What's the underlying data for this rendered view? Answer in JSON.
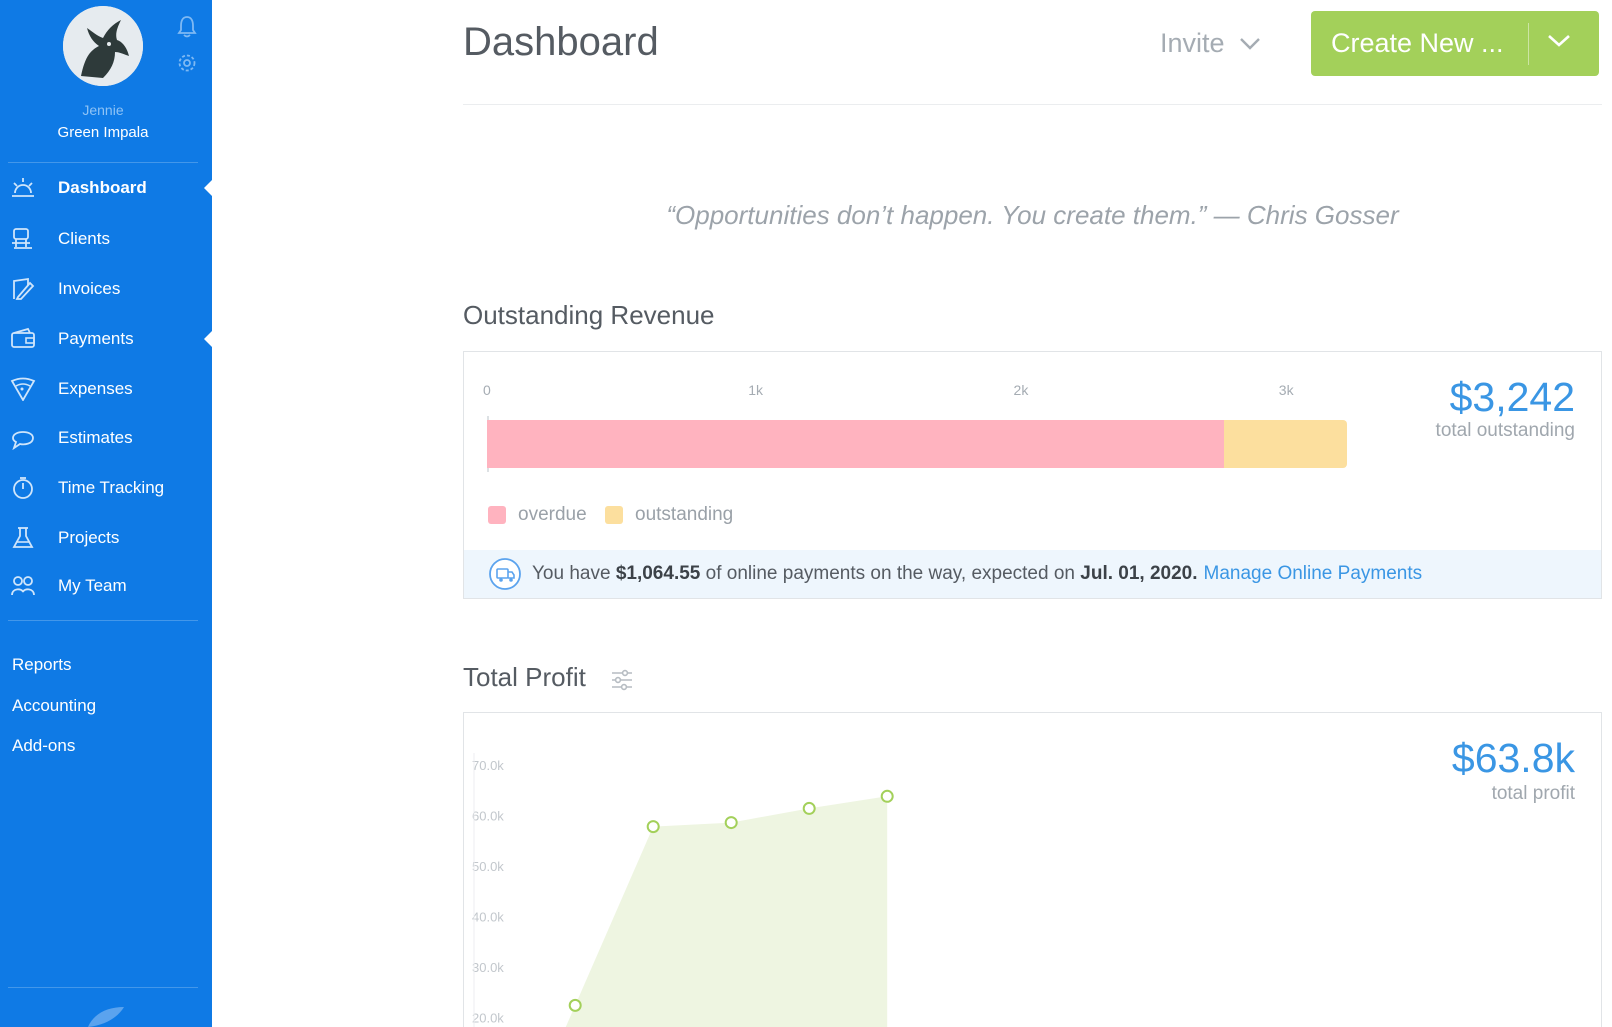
{
  "sidebar": {
    "user_first_name": "Jennie",
    "user_company": "Green Impala",
    "nav": [
      {
        "label": "Dashboard",
        "icon": "sun-icon",
        "active": true
      },
      {
        "label": "Clients",
        "icon": "clients-icon"
      },
      {
        "label": "Invoices",
        "icon": "invoice-icon"
      },
      {
        "label": "Payments",
        "icon": "wallet-icon"
      },
      {
        "label": "Expenses",
        "icon": "expenses-icon"
      },
      {
        "label": "Estimates",
        "icon": "estimate-icon"
      },
      {
        "label": "Time Tracking",
        "icon": "stopwatch-icon"
      },
      {
        "label": "Projects",
        "icon": "flask-icon"
      },
      {
        "label": "My Team",
        "icon": "team-icon"
      }
    ],
    "secondary": [
      "Reports",
      "Accounting",
      "Add-ons"
    ],
    "colors": {
      "background": "#0f7ae5"
    }
  },
  "header": {
    "title": "Dashboard",
    "invite_label": "Invite",
    "create_label": "Create New ...",
    "create_color": "#a3d05a"
  },
  "quote": "“Opportunities don’t happen. You create them.” — Chris Gosser",
  "outstanding": {
    "title": "Outstanding Revenue",
    "amount": "$3,242",
    "amount_label": "total outstanding",
    "ticks": [
      "0",
      "1k",
      "2k",
      "3k"
    ],
    "legend": [
      {
        "label": "overdue",
        "color": "#ffb3bf"
      },
      {
        "label": "outstanding",
        "color": "#fcdf9e"
      }
    ],
    "notice": {
      "prefix": "You have",
      "amount": "$1,064.55",
      "middle": "of online payments on the way, expected on",
      "date": "Jul. 01, 2020.",
      "link": "Manage Online Payments"
    }
  },
  "profit": {
    "title": "Total Profit",
    "amount": "$63.8k",
    "amount_label": "total profit"
  },
  "chart_data": [
    {
      "type": "bar",
      "orientation": "horizontal",
      "stacked": true,
      "categories": [
        "total outstanding"
      ],
      "series": [
        {
          "name": "overdue",
          "values": [
            2780
          ],
          "color": "#ffb3bf"
        },
        {
          "name": "outstanding",
          "values": [
            462
          ],
          "color": "#fcdf9e"
        }
      ],
      "x_ticks": [
        "0",
        "1k",
        "2k",
        "3k"
      ],
      "xlim": [
        0,
        3242
      ]
    },
    {
      "type": "area",
      "x": [
        1,
        2,
        3,
        4,
        5,
        6
      ],
      "values": [
        22.4,
        57.8,
        58.6,
        61.4,
        63.8,
        null
      ],
      "y_ticks": [
        "70.0k",
        "60.0k",
        "50.0k",
        "40.0k",
        "30.0k",
        "20.0k"
      ],
      "ylim": [
        20,
        70
      ],
      "color": "#a3d05a",
      "fill": "#eef5e1"
    }
  ]
}
